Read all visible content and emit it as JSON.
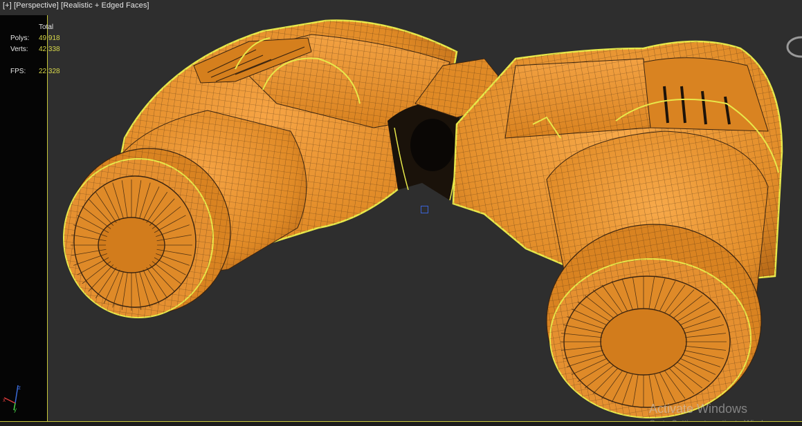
{
  "viewport": {
    "label_plus": "[+]",
    "label_view": "[Perspective]",
    "label_shading": "[Realistic + Edged Faces]"
  },
  "stats": {
    "header": "Total",
    "polys_label": "Polys:",
    "polys_value": "49,918",
    "verts_label": "Verts:",
    "verts_value": "42,338",
    "fps_label": "FPS:",
    "fps_value": "22.328"
  },
  "watermark": {
    "title": "Activate Windows",
    "subtitle": "Go to Settings to activate Windows."
  },
  "colors": {
    "model_fill": "#e8922a",
    "wire": "#3a2410",
    "selection": "#e8e84a",
    "background": "#2e2e2e"
  },
  "icons": [
    "axis-gizmo-icon",
    "viewcube-icon",
    "pivot-marker-icon"
  ]
}
